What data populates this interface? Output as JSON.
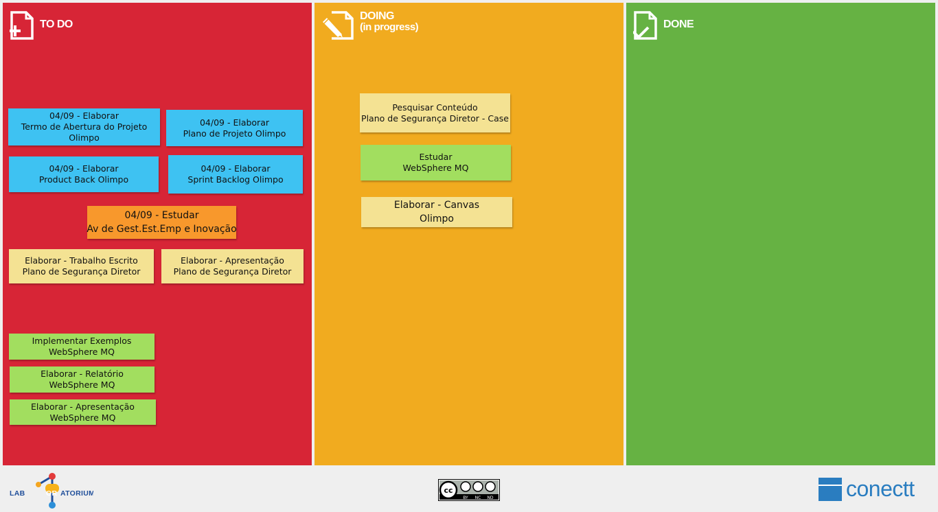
{
  "columns": {
    "todo": {
      "title": "TO DO",
      "color": "#d72536"
    },
    "doing": {
      "title": "DOING",
      "subtitle": "(in progress)",
      "color": "#f1ab1f"
    },
    "done": {
      "title": "DONE",
      "color": "#66b243"
    }
  },
  "todo_notes": [
    {
      "lines": [
        "04/09 - Elaborar",
        "Termo de Abertura do Projeto",
        "Olimpo"
      ],
      "color": "blue"
    },
    {
      "lines": [
        "04/09 - Elaborar",
        "Plano de Projeto Olimpo"
      ],
      "color": "blue"
    },
    {
      "lines": [
        "04/09 - Elaborar",
        "Product Back Olimpo"
      ],
      "color": "blue"
    },
    {
      "lines": [
        "04/09 - Elaborar",
        "Sprint Backlog Olimpo"
      ],
      "color": "blue"
    },
    {
      "lines": [
        "04/09  - Estudar",
        "Av de Gest.Est.Emp e Inovação"
      ],
      "color": "orange"
    },
    {
      "lines": [
        "Elaborar - Trabalho Escrito",
        "Plano de Segurança Diretor"
      ],
      "color": "yellow"
    },
    {
      "lines": [
        "Elaborar - Apresentação",
        "Plano de Segurança Diretor"
      ],
      "color": "yellow"
    },
    {
      "lines": [
        "Implementar Exemplos",
        "WebSphere MQ"
      ],
      "color": "green"
    },
    {
      "lines": [
        "Elaborar - Relatório",
        "WebSphere MQ"
      ],
      "color": "green"
    },
    {
      "lines": [
        "Elaborar - Apresentação",
        "WebSphere MQ"
      ],
      "color": "green"
    }
  ],
  "doing_notes": [
    {
      "lines": [
        "Pesquisar Conteúdo",
        "Plano de Segurança Diretor - Case"
      ],
      "color": "yellow"
    },
    {
      "lines": [
        "Estudar",
        "WebSphere MQ"
      ],
      "color": "green"
    },
    {
      "lines": [
        "Elaborar - Canvas",
        "Olimpo"
      ],
      "color": "yellow"
    }
  ],
  "footer": {
    "lab_logo_text": "LABORATORIUM",
    "cc_license": [
      "BY",
      "NC",
      "ND"
    ],
    "brand": "conectt"
  }
}
